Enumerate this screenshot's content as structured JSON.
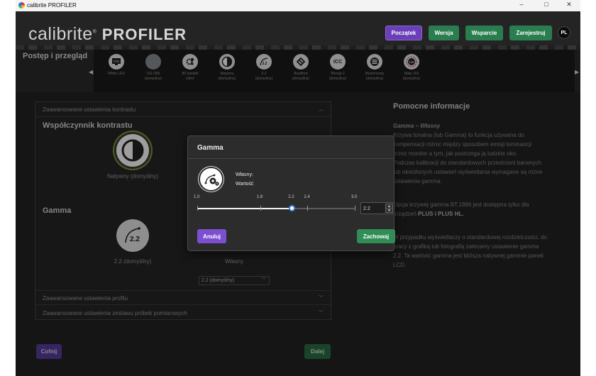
{
  "window": {
    "title": "calibrite PROFILER",
    "min": "–",
    "max": "□",
    "close": "✕"
  },
  "header": {
    "logo_main": "calibrite",
    "logo_pro": "PROFILER",
    "buttons": [
      {
        "label": "Początek",
        "color": "#6a3fb8"
      },
      {
        "label": "Wersja",
        "color": "#2a7d4e"
      },
      {
        "label": "Wsparcie",
        "color": "#2a7d4e"
      },
      {
        "label": "Zarejestruj",
        "color": "#2a7d4e"
      }
    ],
    "lang": "PL"
  },
  "nav": {
    "title": "Postęp i przegląd",
    "steps": [
      {
        "label": "White LED",
        "sub": "",
        "icon": "display-icon"
      },
      {
        "label": "CIE D65",
        "sub": "(domyślny)",
        "icon": "whitepoint-icon"
      },
      {
        "label": "80 kandeli",
        "sub": "cd/m²",
        "icon": "brightness-gear-icon"
      },
      {
        "label": "Natywny",
        "sub": "(domyślny)",
        "icon": "contrast-icon"
      },
      {
        "label": "2.2",
        "sub": "(domyślny)",
        "icon": "gamma-curve-icon"
      },
      {
        "label": "Bradford",
        "sub": "(domyślny)",
        "icon": "bradford-icon"
      },
      {
        "label": "Wersja 2",
        "sub": "(domyślny)",
        "icon": "icc-icon"
      },
      {
        "label": "Macierzowy",
        "sub": "(domyślny)",
        "icon": "matrix-icon"
      },
      {
        "label": "Mały 118",
        "sub": "(domyślny)",
        "icon": "patch-set-icon"
      }
    ]
  },
  "panel": {
    "contrast_header": "Zaawansowane ustawienia kontrastu",
    "contrast_title": "Współczynnik kontrastu",
    "contrast_option": "Natywny (domyślny)",
    "gamma_title": "Gamma",
    "gamma_option": "2.2 (domyślny)",
    "gamma_icon_text": "2.2",
    "custom_option": "Własny",
    "custom_select": "2.2 (domyślny)",
    "profile_header": "Zaawansowane ustawienia profilu",
    "patch_header": "Zaawansowane ustawienia zestawu próbek pomiarowych"
  },
  "help": {
    "title": "Pomocne informacje",
    "p1_title": "Gamma – Własny",
    "p1_lines": [
      "Krzywa tonalna (lub Gamma) to funkcja używana do",
      "kompensacji różnic między sposobem emisji luminancji",
      "przez monitor a tym, jak postrzega ją ludzkie oko.",
      "Podczas kalibracji do standardowych przestrzeni barwnych",
      "lub określonych ustawień wyświetlania wymagane są różne",
      "ustawienia gamma."
    ],
    "p2_line1": "Opcja krzywej gamma BT.1886 jest dostępna tylko dla",
    "p2_line2_prefix": "urządzeń ",
    "p2_line2_bold": "PLUS i PLUS HL.",
    "p3_lines": [
      "W przypadku wyświetlaczy o standardowej rozdzielczości, do",
      "pracy z grafiką lub fotografią zalecamy ustawienie gamma",
      "2.2. Ta wartość gamma jest bliższa natywnej gammie paneli",
      "LCD."
    ]
  },
  "footer": {
    "back": "Cofnij",
    "next": "Dalej"
  },
  "dialog": {
    "title": "Gamma",
    "custom_label": "Własny:",
    "value_label": "Wartość",
    "ticks": [
      "1.0",
      "1.8",
      "2.2",
      "2.4",
      "3.0"
    ],
    "slider": {
      "min": 1.0,
      "max": 3.0,
      "value": 2.2
    },
    "value": "2.2",
    "spin_up": "▲",
    "spin_down": "▼",
    "cancel": "Anuluj",
    "save": "Zachowaj"
  },
  "colors": {
    "purple": "#6a3fb8",
    "green": "#2a7d4e",
    "slider_thumb": "#3d8ae0",
    "ring": "#7a9a30"
  }
}
